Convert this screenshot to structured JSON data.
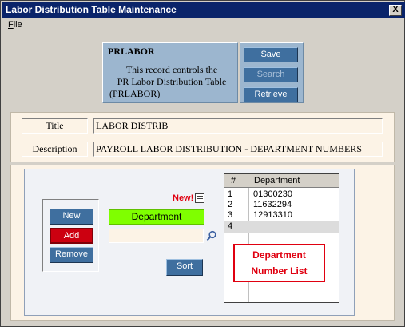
{
  "window": {
    "title": "Labor Distribution Table Maintenance",
    "close_glyph": "X"
  },
  "menu": {
    "file": "File"
  },
  "info": {
    "code": "PRLABOR",
    "description": "This record controls the PR Labor Distribution Table (PRLABOR)",
    "description_lines": [
      "This record controls the",
      "PR Labor Distribution Table",
      "(PRLABOR)"
    ]
  },
  "toolbar": {
    "save": "Save",
    "search": "Search",
    "retrieve": "Retrieve"
  },
  "form": {
    "title_label": "Title",
    "title_value": "LABOR DISTRIB",
    "description_label": "Description",
    "description_value": "PAYROLL LABOR DISTRIBUTION - DEPARTMENT NUMBERS"
  },
  "list_editor": {
    "new_button": "New",
    "add_button": "Add",
    "remove_button": "Remove",
    "field_label": "Department",
    "field_value": "",
    "sort_button": "Sort",
    "new_badge": "New!"
  },
  "grid": {
    "headers": {
      "num": "#",
      "dept": "Department"
    },
    "rows": [
      {
        "num": "1",
        "dept": "01300230"
      },
      {
        "num": "2",
        "dept": "11632294"
      },
      {
        "num": "3",
        "dept": "12913310"
      },
      {
        "num": "4",
        "dept": ""
      }
    ]
  },
  "annotation": {
    "line1": "Department",
    "line2": "Number List"
  },
  "colors": {
    "titlebar": "#0a246a",
    "panel": "#9cb6cf",
    "button": "#3f6f9f",
    "add": "#cc0010",
    "highlight": "#7fff00",
    "annotation": "#e00010"
  }
}
